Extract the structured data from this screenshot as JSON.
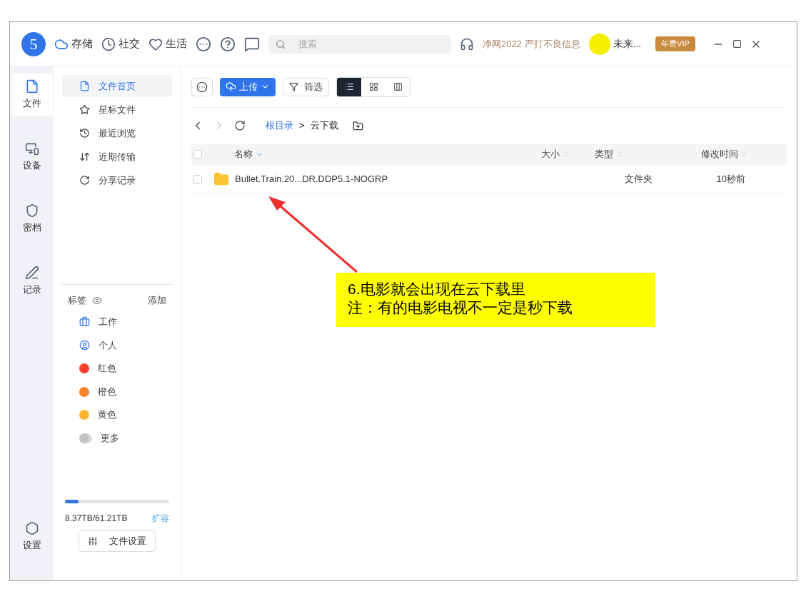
{
  "titlebar": {
    "logo": "5",
    "nav": [
      {
        "label": "存储",
        "kind": "cloud"
      },
      {
        "label": "社交",
        "kind": "clock"
      },
      {
        "label": "生活",
        "kind": "heart"
      }
    ],
    "search": {
      "placeholder": "搜索"
    },
    "notice": "净网2022 严打不良信息",
    "user": "未来...",
    "vip": "年费VIP"
  },
  "rail": [
    {
      "label": "文件",
      "kind": "file",
      "selected": true
    },
    {
      "label": "设备",
      "kind": "device",
      "selected": false
    },
    {
      "label": "密档",
      "kind": "shield",
      "selected": false
    },
    {
      "label": "记录",
      "kind": "pen",
      "selected": false
    }
  ],
  "rail_bottom": {
    "label": "设置"
  },
  "nav": [
    {
      "label": "文件首页",
      "kind": "file",
      "selected": true
    },
    {
      "label": "星标文件",
      "kind": "star",
      "selected": false
    },
    {
      "label": "最近浏览",
      "kind": "history",
      "selected": false
    },
    {
      "label": "近期传输",
      "kind": "transfer",
      "selected": false
    },
    {
      "label": "分享记录",
      "kind": "share",
      "selected": false
    }
  ],
  "tags": {
    "title": "标签",
    "add": "添加",
    "items": [
      {
        "label": "工作",
        "kind": "briefcase"
      },
      {
        "label": "个人",
        "kind": "person"
      },
      {
        "label": "红色",
        "kind": "dot",
        "color": "#f5402c"
      },
      {
        "label": "橙色",
        "kind": "dot",
        "color": "#f7862a"
      },
      {
        "label": "黄色",
        "kind": "dot",
        "color": "#fdb62f"
      },
      {
        "label": "更多",
        "kind": "more"
      }
    ]
  },
  "storage": {
    "level": 0.13,
    "reading": "8.37TB/61.21TB",
    "expand": "扩容",
    "settings": "文件设置"
  },
  "toolbar": {
    "upload": "上传",
    "filter": "筛选",
    "views": [
      {
        "kind": "list",
        "selected": true
      },
      {
        "kind": "grid",
        "selected": false
      },
      {
        "kind": "columns",
        "selected": false
      }
    ]
  },
  "breadcrumb": {
    "separator": ">",
    "items": [
      {
        "label": "根目录",
        "current": false
      },
      {
        "label": "云下载",
        "current": true
      }
    ]
  },
  "table": {
    "all_checked": false,
    "columns": [
      {
        "label": "名称",
        "sorted": true
      },
      {
        "label": "大小",
        "sorted": false
      },
      {
        "label": "类型",
        "sorted": false
      },
      {
        "label": "修改时间",
        "sorted": false
      }
    ],
    "rows": [
      {
        "checked": false,
        "name": "Bullet.Train.20...DR.DDP5.1-NOGRP",
        "type": "文件夹",
        "modified": "10秒前"
      }
    ]
  },
  "annotation": {
    "lines": [
      "6.电影就会出现在云下载里",
      "注：有的电影电视不一定是秒下载"
    ]
  }
}
